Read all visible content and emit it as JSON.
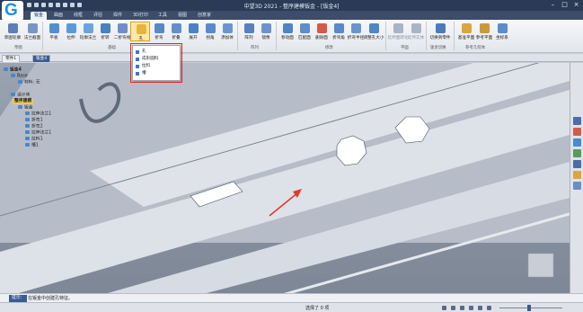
{
  "app": {
    "title": "中望3D 2021 - 整序建模钣金 - [钣金4]",
    "logo_letter": "G"
  },
  "window_controls": {
    "minimize": "–",
    "maximize": "□",
    "close": "×"
  },
  "ribbon_tabs": [
    "钣金",
    "曲面",
    "线框",
    "评估",
    "焊件",
    "3D打印",
    "工具",
    "视图",
    "创意家"
  ],
  "ribbon": {
    "buttons": [
      {
        "label": "草图轮廓"
      },
      {
        "label": "法兰截面"
      },
      {
        "label": "平板"
      },
      {
        "label": "拉伸"
      },
      {
        "label": "轮廓法兰"
      },
      {
        "label": "折转"
      },
      {
        "label": "二折弯线"
      },
      {
        "label": "孔"
      },
      {
        "label": "折弯"
      },
      {
        "label": "折叠"
      },
      {
        "label": "展开"
      },
      {
        "label": "拐角"
      },
      {
        "label": "添加体"
      },
      {
        "label": "阵列"
      },
      {
        "label": "镜像"
      },
      {
        "label": "移动面"
      },
      {
        "label": "匹配面"
      },
      {
        "label": "删除面"
      },
      {
        "label": "折弯角"
      },
      {
        "label": "折弯半径"
      },
      {
        "label": "调整孔大小"
      },
      {
        "label": "延伸面转化"
      },
      {
        "label": "延伸实体"
      },
      {
        "label": "切换到零件"
      },
      {
        "label": "基准平面"
      },
      {
        "label": "参考平面"
      },
      {
        "label": "坐标系"
      }
    ],
    "groups": [
      "草图",
      "基础",
      "阵列",
      "修改",
      "平面",
      "钣金切换",
      "参考几何体"
    ]
  },
  "dropdown": {
    "items": [
      {
        "label": "孔"
      },
      {
        "label": "成形圆料"
      },
      {
        "label": "拉料"
      },
      {
        "label": "槽"
      }
    ]
  },
  "doc_tabs": [
    "零件1",
    "钣金4"
  ],
  "tree": {
    "nodes": [
      {
        "label": "钣金4"
      },
      {
        "label": "Base"
      },
      {
        "label": "材料: 无"
      },
      {
        "label": "设计体"
      },
      {
        "label": "整序建模"
      },
      {
        "label": "钣金"
      },
      {
        "label": "拉伸法兰1"
      },
      {
        "label": "折弯1"
      },
      {
        "label": "折弯2"
      },
      {
        "label": "拉伸法兰1"
      },
      {
        "label": "拉料1"
      },
      {
        "label": "槽1"
      }
    ]
  },
  "command": {
    "label": "提示：",
    "text": "在钣金中创建孔特征。"
  },
  "status": {
    "selection": "选择了 0 项"
  },
  "colors": {
    "accent": "#3a5b8f",
    "highlight": "#e0281e",
    "selected_node": "#f1c84a"
  }
}
